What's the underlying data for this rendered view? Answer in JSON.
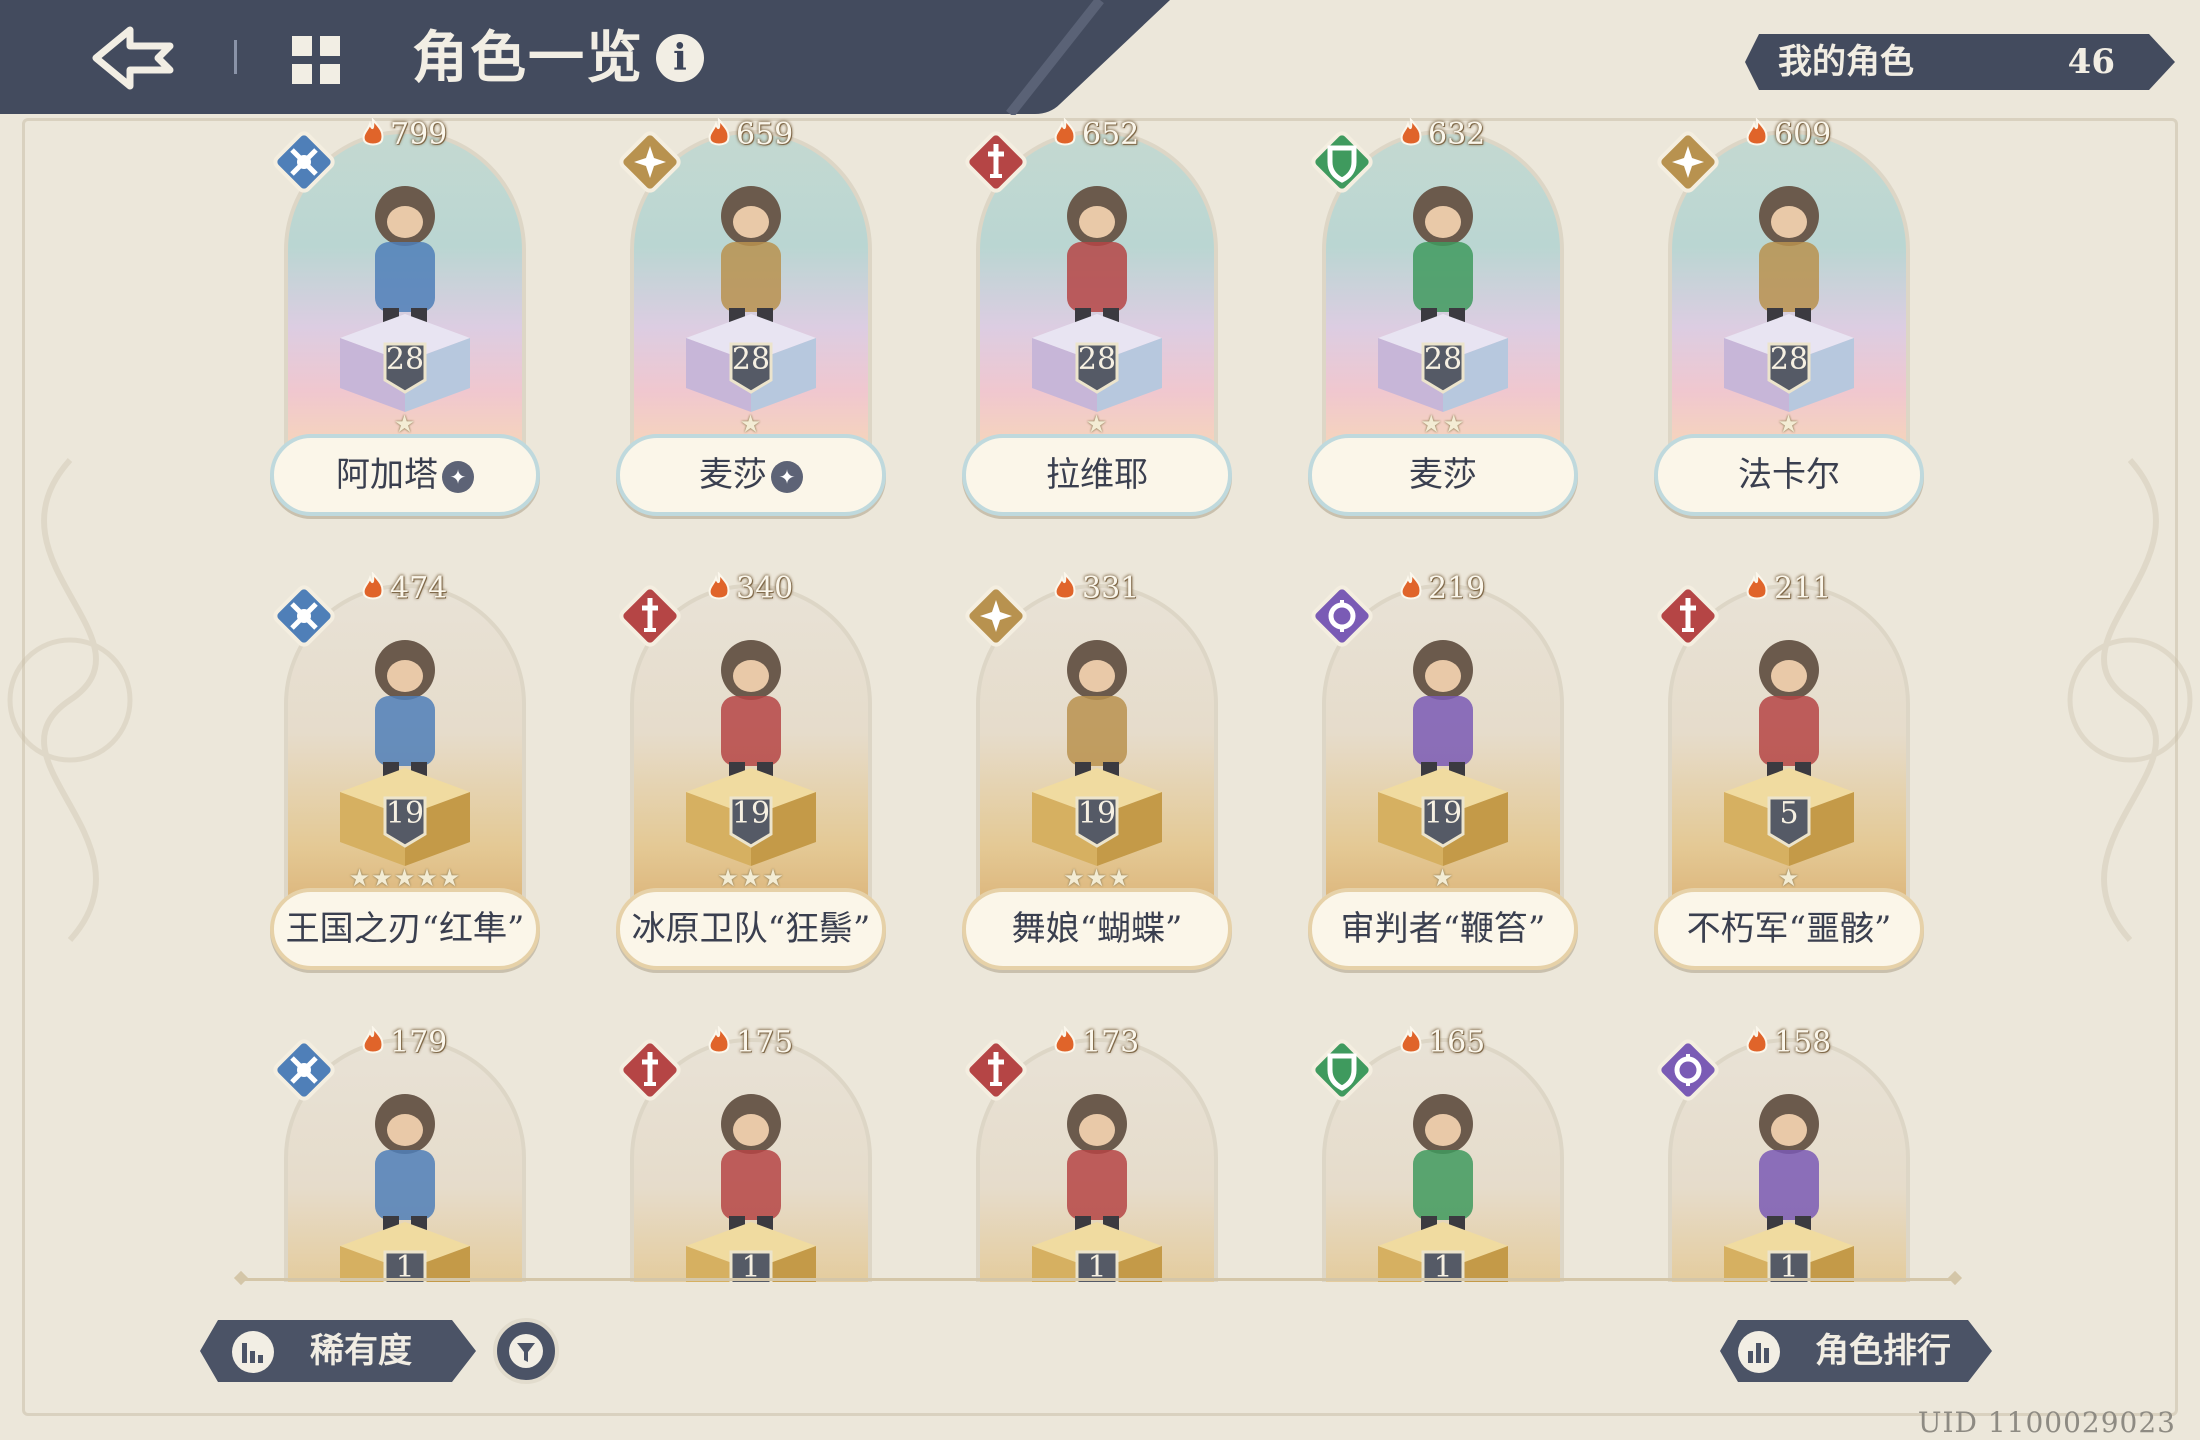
{
  "header": {
    "title": "角色一览",
    "info_glyph": "i"
  },
  "my_characters": {
    "label": "我的角色",
    "count": "46"
  },
  "colors": {
    "header_bg": "#434b5e",
    "paper": "#ece7da",
    "gold_frame": "#e6d1a8",
    "rainbow_frame": "#bfd9dd"
  },
  "characters": [
    {
      "name": "阿加塔",
      "power": "799",
      "level": "28",
      "stars": "★",
      "class_icon": "wind-class-icon",
      "class_color": "#4f7fb8",
      "frame": "rainbow",
      "awaken": true
    },
    {
      "name": "麦莎",
      "power": "659",
      "level": "28",
      "stars": "★",
      "class_icon": "star-class-icon",
      "class_color": "#b8924f",
      "frame": "rainbow",
      "awaken": true
    },
    {
      "name": "拉维耶",
      "power": "652",
      "level": "28",
      "stars": "★",
      "class_icon": "sword-class-icon",
      "class_color": "#b54545",
      "frame": "rainbow",
      "awaken": false
    },
    {
      "name": "麦莎",
      "power": "632",
      "level": "28",
      "stars": "★★",
      "class_icon": "shield-class-icon",
      "class_color": "#3f9a5e",
      "frame": "rainbow",
      "awaken": false
    },
    {
      "name": "法卡尔",
      "power": "609",
      "level": "28",
      "stars": "★",
      "class_icon": "star-class-icon",
      "class_color": "#b8924f",
      "frame": "rainbow",
      "awaken": false
    },
    {
      "name": "王国之刃“红隼”",
      "power": "474",
      "level": "19",
      "stars": "★★★★★",
      "class_icon": "wind-class-icon",
      "class_color": "#4f7fb8",
      "frame": "gold",
      "awaken": false
    },
    {
      "name": "冰原卫队“狂鬃”",
      "power": "340",
      "level": "19",
      "stars": "★★★",
      "class_icon": "sword-class-icon",
      "class_color": "#b54545",
      "frame": "gold",
      "awaken": false
    },
    {
      "name": "舞娘“蝴蝶”",
      "power": "331",
      "level": "19",
      "stars": "★★★",
      "class_icon": "star-class-icon",
      "class_color": "#b8924f",
      "frame": "gold",
      "awaken": false
    },
    {
      "name": "审判者“鞭笞”",
      "power": "219",
      "level": "19",
      "stars": "★",
      "class_icon": "magic-class-icon",
      "class_color": "#7a5bb5",
      "frame": "gold",
      "awaken": false
    },
    {
      "name": "不朽军“噩骸”",
      "power": "211",
      "level": "5",
      "stars": "★",
      "class_icon": "sword-class-icon",
      "class_color": "#b54545",
      "frame": "gold",
      "awaken": false
    },
    {
      "name": "",
      "power": "179",
      "level": "1",
      "stars": "",
      "class_icon": "wind-class-icon",
      "class_color": "#4f7fb8",
      "frame": "gold",
      "awaken": false
    },
    {
      "name": "",
      "power": "175",
      "level": "1",
      "stars": "",
      "class_icon": "sword-class-icon",
      "class_color": "#b54545",
      "frame": "gold",
      "awaken": false
    },
    {
      "name": "",
      "power": "173",
      "level": "1",
      "stars": "",
      "class_icon": "sword-class-icon",
      "class_color": "#b54545",
      "frame": "gold",
      "awaken": false
    },
    {
      "name": "",
      "power": "165",
      "level": "1",
      "stars": "",
      "class_icon": "shield-class-icon",
      "class_color": "#3f9a5e",
      "frame": "gold",
      "awaken": false
    },
    {
      "name": "",
      "power": "158",
      "level": "1",
      "stars": "",
      "class_icon": "magic-class-icon",
      "class_color": "#7a5bb5",
      "frame": "gold",
      "awaken": false
    }
  ],
  "bottom": {
    "rarity_label": "稀有度",
    "ranking_label": "角色排行"
  },
  "uid": "UID 1100029023"
}
